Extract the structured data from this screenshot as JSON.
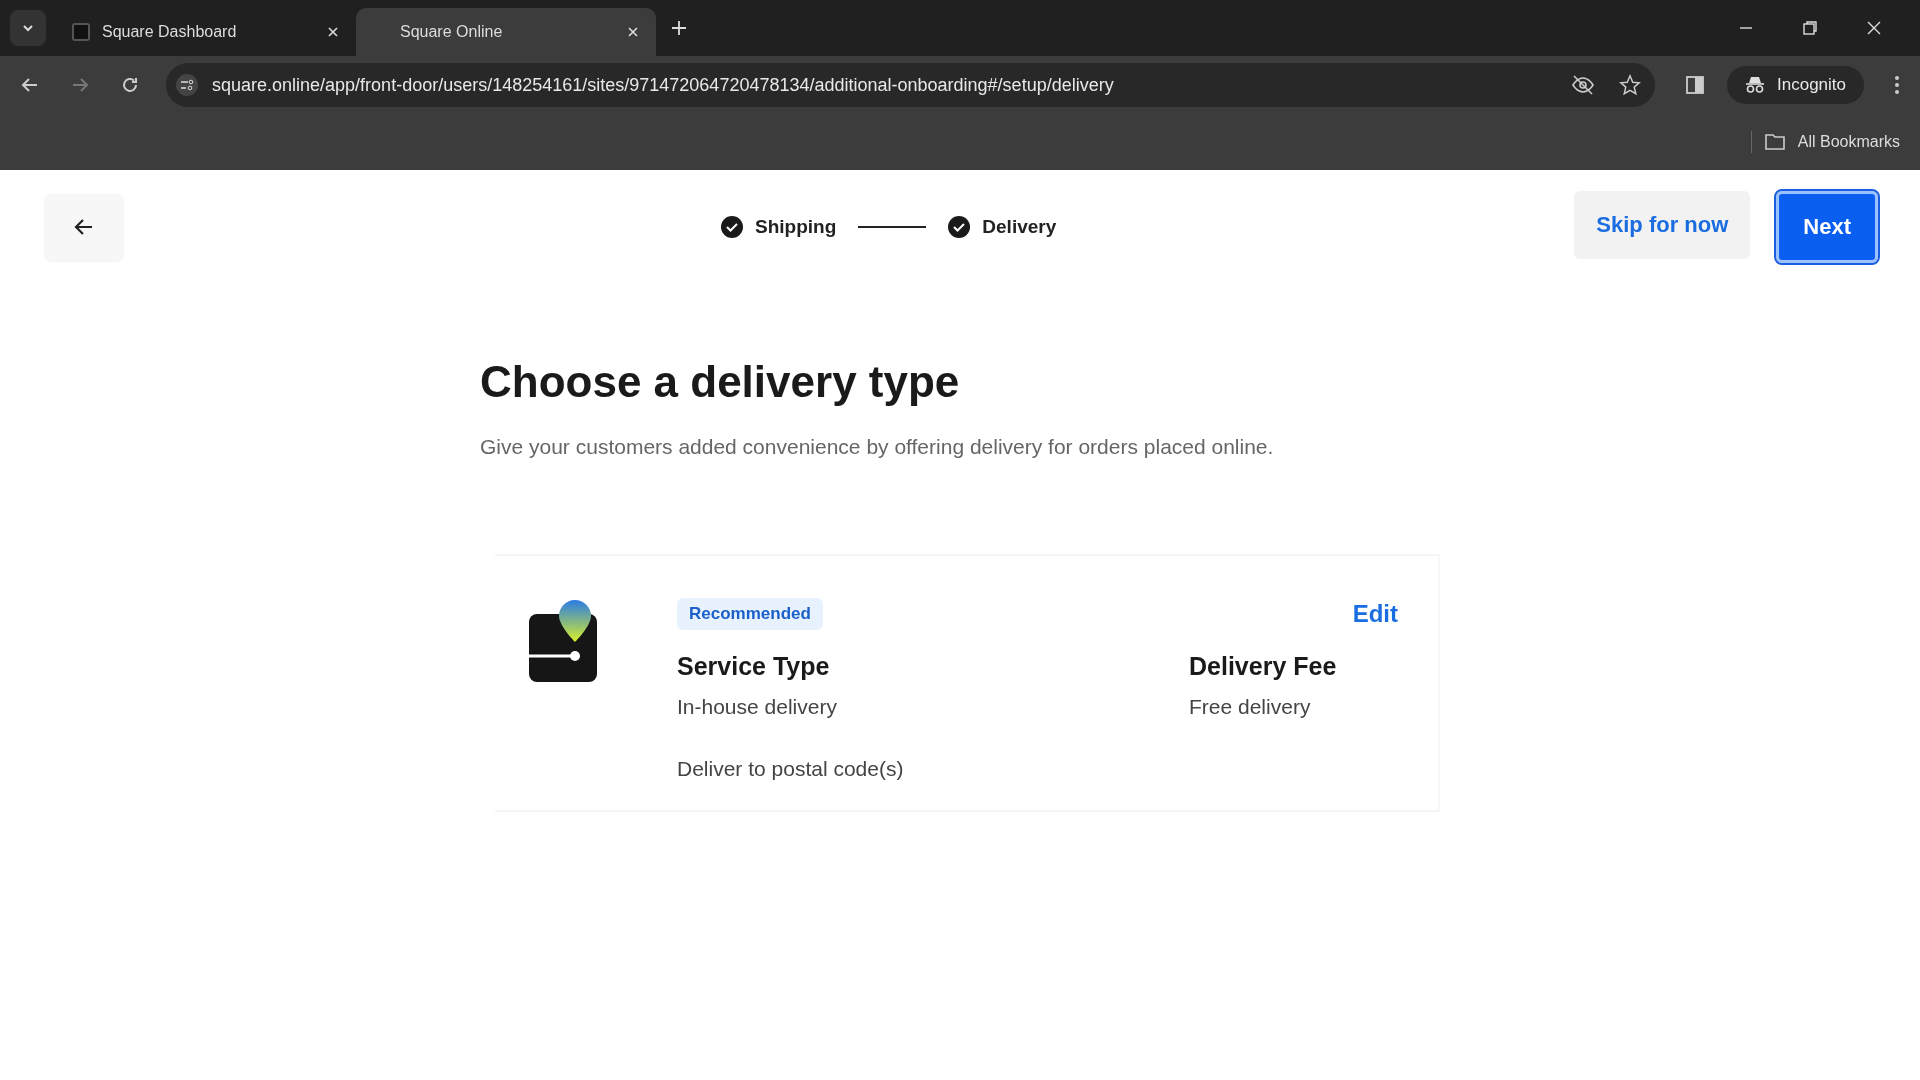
{
  "browser": {
    "tabs": [
      {
        "title": "Square Dashboard",
        "selected": false
      },
      {
        "title": "Square Online",
        "selected": true
      }
    ],
    "address": "square.online/app/front-door/users/148254161/sites/971472064720478134/additional-onboarding#/setup/delivery",
    "profile": "Incognito",
    "bookmarks": "All Bookmarks"
  },
  "header": {
    "steps": [
      {
        "label": "Shipping",
        "done": true
      },
      {
        "label": "Delivery",
        "done": true
      }
    ],
    "skip_button": "Skip for now",
    "next_button": "Next"
  },
  "title": "Choose a delivery type",
  "subtitle": "Give your customers added convenience by offering delivery for orders placed online.",
  "card": {
    "badge": "Recommended",
    "edit": "Edit",
    "fields": [
      {
        "label": "Service Type",
        "value": "In-house delivery"
      },
      {
        "label": "Delivery Fee",
        "value": "Free delivery"
      }
    ],
    "note": "Deliver to postal code(s)"
  }
}
